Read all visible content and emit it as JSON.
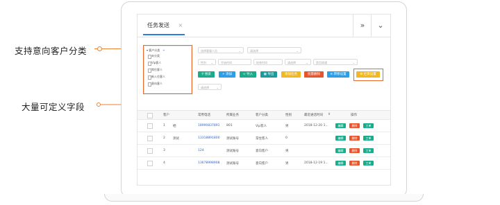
{
  "annotations": {
    "top": "支持意向客户分类",
    "bottom": "大量可定义字段"
  },
  "colors": {
    "accent": "#f08232",
    "link": "#2d62d0",
    "tab_active": "#2d7be0"
  },
  "tab": {
    "label": "任务发送",
    "close": "×"
  },
  "top_controls": {
    "expand": "»",
    "dropdown": "⌄"
  },
  "tree": {
    "root": "客户分类",
    "add": "+",
    "items": [
      "未分类",
      "Vip客人",
      "常住客人",
      "新入住客人",
      "意向客人"
    ]
  },
  "filters": {
    "row1": [
      "选择客服人员",
      "请选择"
    ],
    "row2": [
      "性别",
      "开始时间",
      "结束时间",
      "请选择",
      "是否拨通"
    ],
    "row3": [
      "请选择"
    ]
  },
  "buttons": [
    {
      "label": "搜索",
      "icon": "search-icon",
      "color": "#1aab8a"
    },
    {
      "label": "添加",
      "icon": "plus-icon",
      "color": "#2e9fe6"
    },
    {
      "label": "导入",
      "icon": "link-icon",
      "color": "#1aab8a"
    },
    {
      "label": "导出",
      "icon": "grid-icon",
      "color": "#1a9c9c"
    },
    {
      "label": "添加任务",
      "icon": "",
      "color": "#f2b821"
    },
    {
      "label": "批量删除",
      "icon": "",
      "color": "#e8552c"
    },
    {
      "label": "转移设置",
      "icon": "list-icon",
      "color": "#2e9fe6"
    },
    {
      "label": "栏目设置",
      "icon": "gear-icon",
      "color": "#f2b821"
    }
  ],
  "table": {
    "headers": [
      "客户",
      "常用电话",
      "所属业务",
      "客户分类",
      "性别",
      "最近通话时间",
      "操作"
    ],
    "sort_icon": "⇕",
    "rows": [
      {
        "index": "1",
        "name": "栖",
        "phone": "18990837891",
        "business": "801",
        "category": "Vip客人",
        "gender": "男",
        "last_call": "2018-12-20 1..."
      },
      {
        "index": "2",
        "name": "测试",
        "phone": "13318891800",
        "business": "测试账号",
        "category": "常住客人",
        "gender": "0",
        "last_call": ""
      },
      {
        "index": "3",
        "name": "",
        "phone": "124",
        "business": "测试账号",
        "category": "意向客户",
        "gender": "男",
        "last_call": ""
      },
      {
        "index": "4",
        "name": "",
        "phone": "13678998908",
        "business": "测试账号",
        "category": "意向客户",
        "gender": "男",
        "last_call": "2018-12-19 1..."
      }
    ],
    "actions": [
      {
        "label": "编辑",
        "color": "#1aab8a"
      },
      {
        "label": "删除",
        "color": "#e8552c"
      },
      {
        "label": "工单",
        "color": "#1aab8a"
      }
    ]
  }
}
